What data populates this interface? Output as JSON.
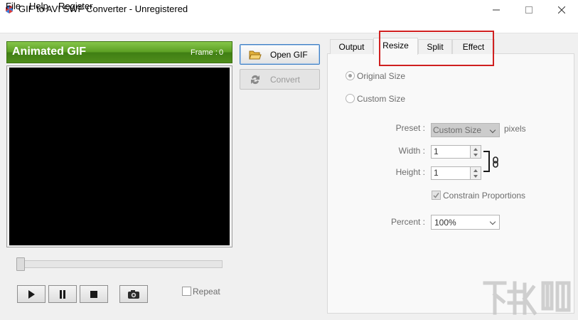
{
  "window": {
    "title": "GIF to AVI SWF Converter - Unregistered",
    "controls": {
      "minimize": "—",
      "maximize": "☐",
      "close": "✕"
    }
  },
  "menu": {
    "file": "File",
    "help": "Help",
    "register": "Register"
  },
  "preview": {
    "header_title": "Animated GIF",
    "frame_label": "Frame :",
    "frame_value": "0",
    "seek_position": 0,
    "repeat_label": "Repeat",
    "repeat_checked": false
  },
  "actions": {
    "open_label": "Open GIF",
    "convert_label": "Convert"
  },
  "tabs": [
    "Output",
    "Resize",
    "Split",
    "Effect"
  ],
  "active_tab": "Resize",
  "resize": {
    "original_size_label": "Original Size",
    "custom_size_label": "Custom Size",
    "selected_option": "Original Size",
    "preset_label": "Preset :",
    "preset_value": "Custom Size",
    "pixels_label": "pixels",
    "width_label": "Width :",
    "width_value": "1",
    "height_label": "Height :",
    "height_value": "1",
    "constrain_label": "Constrain Proportions",
    "constrain_checked": true,
    "percent_label": "Percent :",
    "percent_value": "100%"
  },
  "colors": {
    "header_green": "#5a9d22",
    "highlight_red": "#d02020",
    "open_button_border": "#3f7fc4",
    "disabled_text": "#6d6d6d"
  },
  "icons": {
    "app": "app-logo-icon",
    "open": "folder-open-icon",
    "convert": "convert-arrows-icon",
    "play": "play-icon",
    "pause": "pause-icon",
    "stop": "stop-icon",
    "snapshot": "camera-icon",
    "link": "chain-link-icon"
  }
}
